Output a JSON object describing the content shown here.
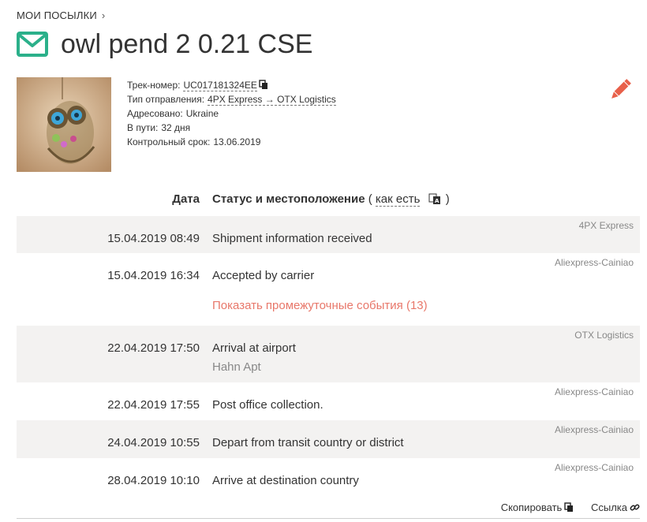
{
  "breadcrumb": {
    "label": "МОИ ПОСЫЛКИ",
    "chevron": "›"
  },
  "title": "owl pend 2 0.21 CSE",
  "icons": {
    "title": "envelope-icon",
    "edit": "pencil-icon",
    "copy": "copy-icon",
    "link": "link-icon",
    "translate": "translate-icon"
  },
  "colors": {
    "accent_green": "#2bb08a",
    "edit_orange": "#e8604a",
    "link_red": "#e8776a",
    "row_shade": "#f3f2f1"
  },
  "info": {
    "tracking_label": "Трек-номер:",
    "tracking_value": "UC017181324EE",
    "type_label": "Тип отправления:",
    "type_value": "4PX Express → OTX Logistics",
    "addressed_label": "Адресовано:",
    "addressed_value": "Ukraine",
    "transit_label": "В пути:",
    "transit_value": "32 дня",
    "deadline_label": "Контрольный срок:",
    "deadline_value": "13.06.2019"
  },
  "table": {
    "date_header": "Дата",
    "status_header": "Статус и местоположение",
    "open_paren": "(",
    "as_is_link": "как есть",
    "close_paren": ")"
  },
  "events": [
    {
      "date": "15.04.2019 08:49",
      "status": "Shipment information received",
      "carrier": "4PX Express",
      "location": ""
    },
    {
      "date": "15.04.2019 16:34",
      "status": "Accepted by carrier",
      "carrier": "Aliexpress-Cainiao",
      "location": ""
    },
    {
      "date": "22.04.2019 17:50",
      "status": "Arrival at airport",
      "carrier": "OTX Logistics",
      "location": "Hahn Apt"
    },
    {
      "date": "22.04.2019 17:55",
      "status": "Post office collection.",
      "carrier": "Aliexpress-Cainiao",
      "location": ""
    },
    {
      "date": "24.04.2019 10:55",
      "status": "Depart from transit country or district",
      "carrier": "Aliexpress-Cainiao",
      "location": ""
    },
    {
      "date": "28.04.2019 10:10",
      "status": "Arrive at destination country",
      "carrier": "Aliexpress-Cainiao",
      "location": ""
    }
  ],
  "show_more": "Показать промежуточные события (13)",
  "footer": {
    "copy_label": "Скопировать",
    "link_label": "Ссылка"
  }
}
